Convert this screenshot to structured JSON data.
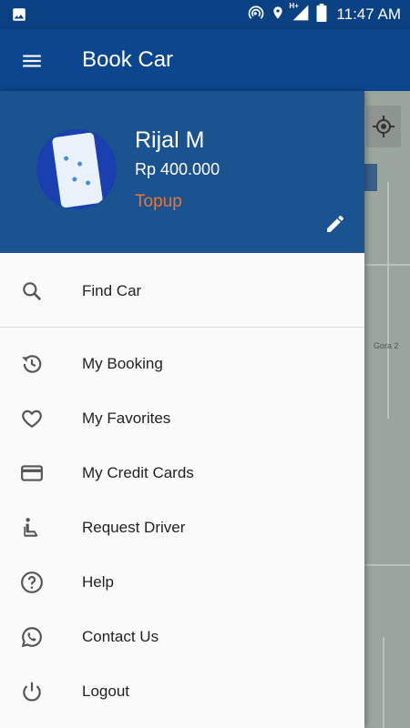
{
  "status_bar": {
    "time": "11:47 AM",
    "network": "H+"
  },
  "app_bar": {
    "title": "Book Car"
  },
  "profile": {
    "name": "Rijal M",
    "balance": "Rp 400.000",
    "topup_label": "Topup"
  },
  "menu": {
    "find_car": "Find Car",
    "my_booking": "My Booking",
    "my_favorites": "My Favorites",
    "my_credit_cards": "My Credit Cards",
    "request_driver": "Request Driver",
    "help": "Help",
    "contact_us": "Contact Us",
    "logout": "Logout"
  },
  "map": {
    "place_label": "Gora 2"
  },
  "colors": {
    "primary_dark": "#0a4183",
    "primary": "#0b468f",
    "header": "#1b5290",
    "accent": "#e87533"
  }
}
